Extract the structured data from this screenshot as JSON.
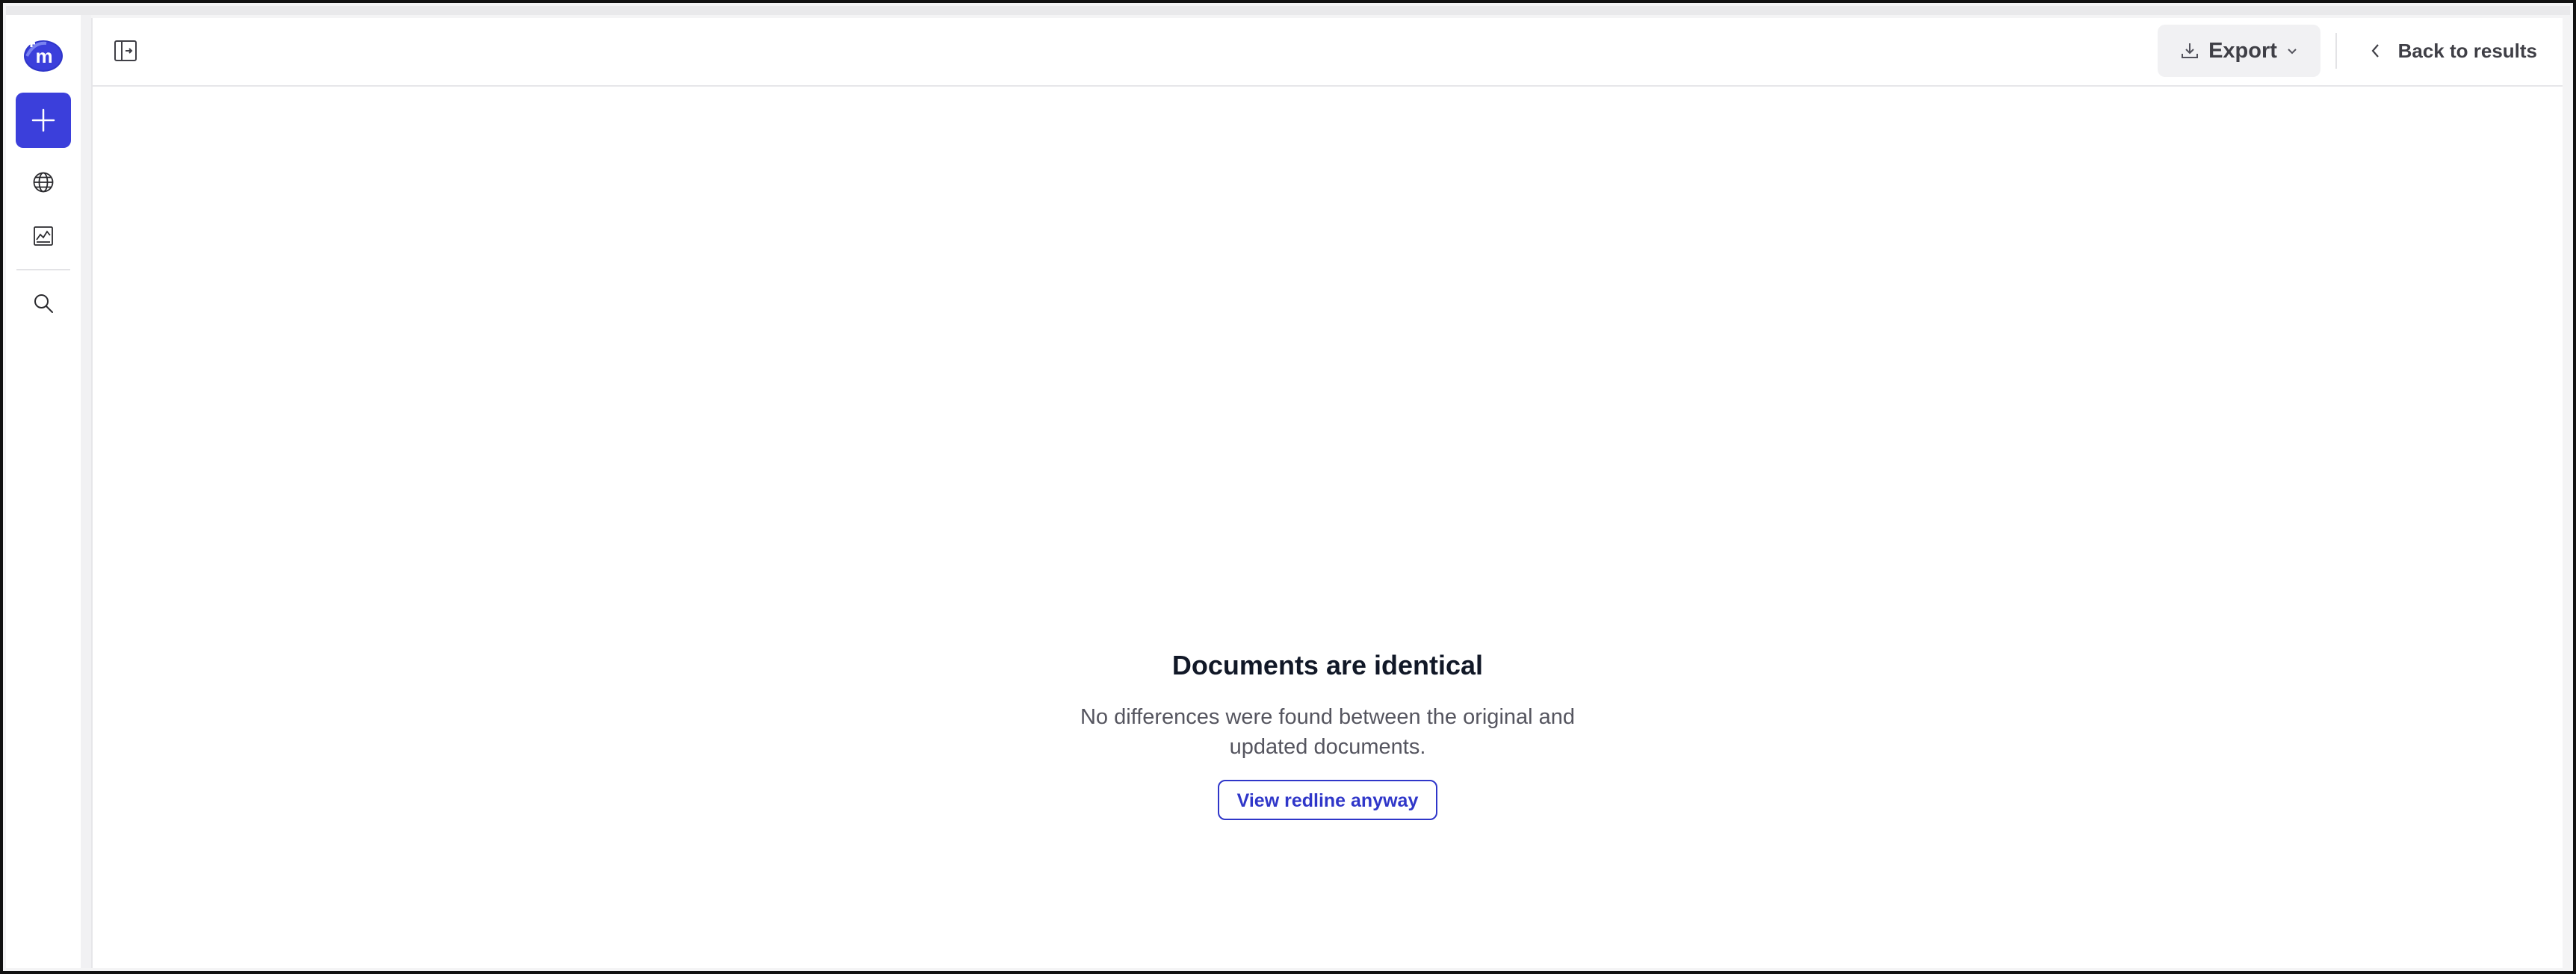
{
  "app": {
    "logo_letter": "m"
  },
  "rail": {
    "items": [
      {
        "icon": "plus-icon",
        "label": "New"
      },
      {
        "icon": "globe-icon",
        "label": "Globe"
      },
      {
        "icon": "chart-icon",
        "label": "Analytics"
      },
      {
        "icon": "search-icon",
        "label": "Search"
      }
    ]
  },
  "header": {
    "export_label": "Export",
    "back_label": "Back to results"
  },
  "empty_state": {
    "title": "Documents are identical",
    "description": "No differences were found between the original and updated documents.",
    "action_label": "View redline anyway"
  },
  "colors": {
    "accent": "#3b3fdb",
    "link": "#2f36c9",
    "text_muted": "#55555f"
  }
}
